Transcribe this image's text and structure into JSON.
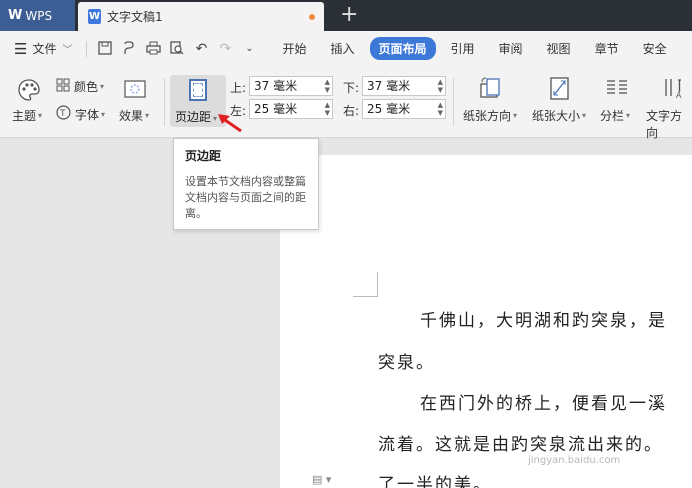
{
  "titlebar": {
    "app_name": "WPS",
    "doc_tab": "文字文稿1",
    "add_tab": "+"
  },
  "menubar": {
    "file_label": "文件",
    "tabs": [
      "开始",
      "插入",
      "页面布局",
      "引用",
      "审阅",
      "视图",
      "章节",
      "安全"
    ],
    "active_tab": "页面布局"
  },
  "ribbon": {
    "theme_label": "主题",
    "color_label": "颜色",
    "font_label": "字体",
    "effect_label": "效果",
    "margin_label": "页边距",
    "top_label": "上:",
    "top_value": "37 毫米",
    "bottom_label": "下:",
    "bottom_value": "37 毫米",
    "left_label": "左:",
    "left_value": "25 毫米",
    "right_label": "右:",
    "right_value": "25 毫米",
    "orientation_label": "纸张方向",
    "size_label": "纸张大小",
    "columns_label": "分栏",
    "text_direction_label": "文字方向"
  },
  "tooltip": {
    "title": "页边距",
    "body": "设置本节文档内容或整篇文档内容与页面之间的距离。"
  },
  "document": {
    "line1": "千佛山，大明湖和趵突泉，是",
    "line2": "突泉。",
    "line3": "在西门外的桥上，便看见一溪",
    "line4": "流着。这就是由趵突泉流出来的。",
    "line5": "了一半的美。"
  },
  "watermark": "jingyan.baidu.com",
  "colors": {
    "titlebar_bg": "#2b2f36",
    "wps_tab_bg": "#3d5d95",
    "accent": "#3c78d8",
    "arrow": "#e02020"
  }
}
